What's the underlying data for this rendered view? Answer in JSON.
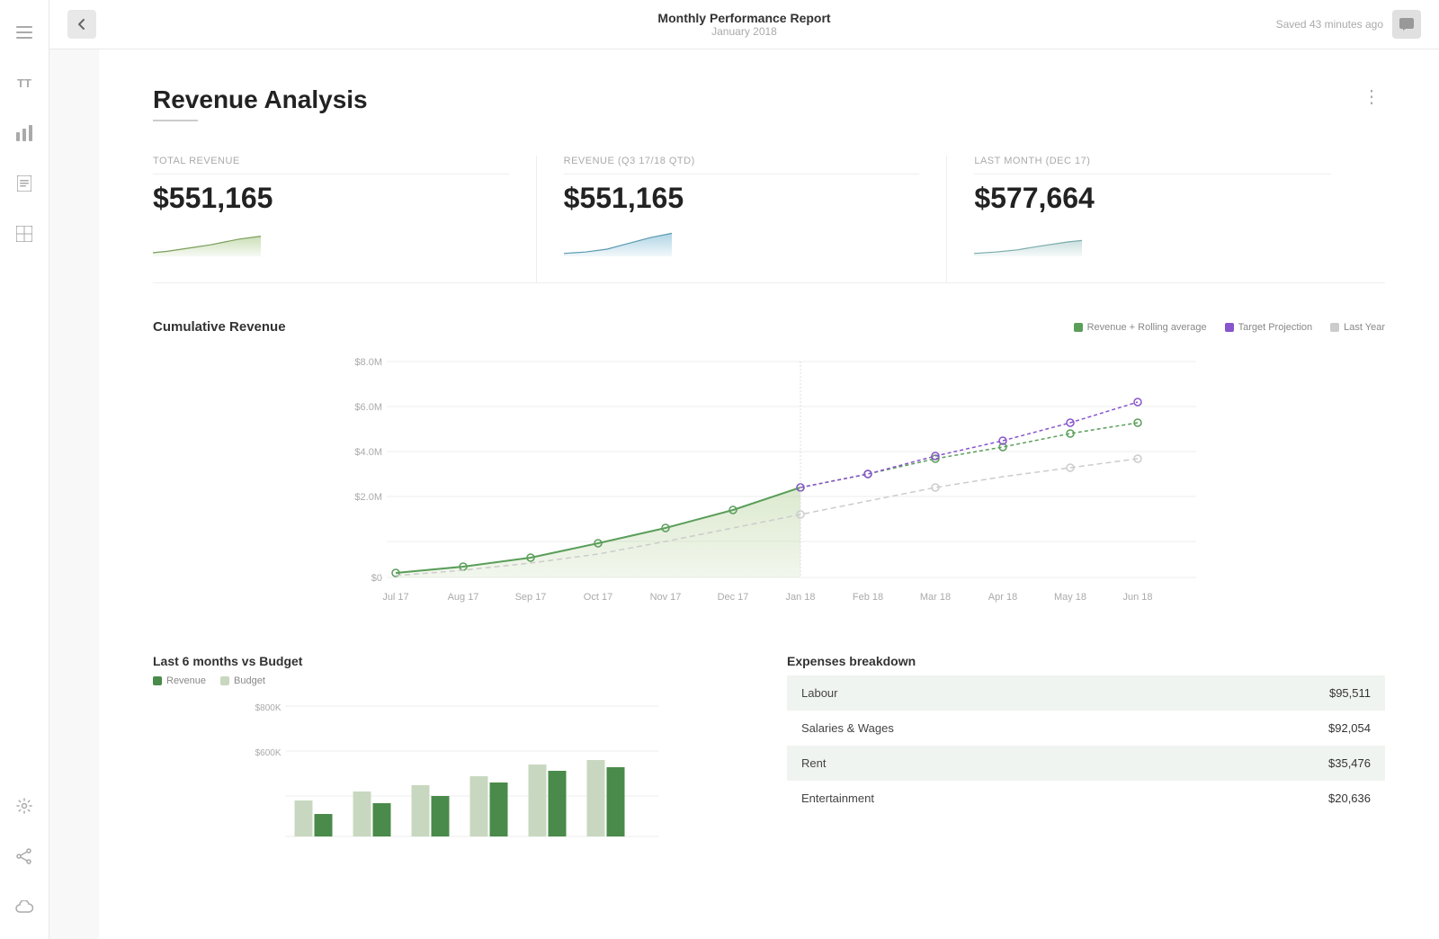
{
  "topbar": {
    "back_label": "←",
    "title": "Monthly Performance Report",
    "subtitle": "January 2018",
    "save_status": "Saved 43 minutes ago",
    "chat_icon": "💬"
  },
  "sidebar": {
    "icons": [
      {
        "name": "menu-icon",
        "glyph": "☰"
      },
      {
        "name": "text-icon",
        "glyph": "TT"
      },
      {
        "name": "chart-icon",
        "glyph": "📊"
      },
      {
        "name": "table-icon",
        "glyph": "📋"
      },
      {
        "name": "grid-icon",
        "glyph": "⊞"
      }
    ],
    "bottom_icons": [
      {
        "name": "settings-icon",
        "glyph": "⚙"
      },
      {
        "name": "share-icon",
        "glyph": "↗"
      },
      {
        "name": "cloud-icon",
        "glyph": "☁"
      }
    ]
  },
  "section": {
    "title": "Revenue Analysis",
    "more_label": "⋮"
  },
  "kpis": [
    {
      "label": "TOTAL REVENUE",
      "value": "$551,165",
      "sparkline_color": "#a8c987"
    },
    {
      "label": "REVENUE (Q3 17/18 QTD)",
      "value": "$551,165",
      "sparkline_color": "#7bb8d4"
    },
    {
      "label": "LAST MONTH (Dec 17)",
      "value": "$577,664",
      "sparkline_color": "#a8c9c9"
    }
  ],
  "cumulative_chart": {
    "title": "Cumulative Revenue",
    "y_labels": [
      "$8.0M",
      "$6.0M",
      "$4.0M",
      "$2.0M",
      "$0"
    ],
    "x_labels": [
      "Jul 17",
      "Aug 17",
      "Sep 17",
      "Oct 17",
      "Nov 17",
      "Dec 17",
      "Jan 18",
      "Feb 18",
      "Mar 18",
      "Apr 18",
      "May 18",
      "Jun 18"
    ],
    "legend": [
      {
        "label": "Revenue + Rolling average",
        "color": "#5a9e5a"
      },
      {
        "label": "Target Projection",
        "color": "#8855cc"
      },
      {
        "label": "Last Year",
        "color": "#cccccc"
      }
    ]
  },
  "bar_chart": {
    "title": "Last 6 months vs Budget",
    "y_labels": [
      "$800K",
      "$600K"
    ],
    "legend": [
      {
        "label": "Revenue",
        "color": "#4a8a4a"
      },
      {
        "label": "Budget",
        "color": "#c8d8c0"
      }
    ]
  },
  "expenses": {
    "title": "Expenses breakdown",
    "items": [
      {
        "label": "Labour",
        "amount": "$95,511"
      },
      {
        "label": "Salaries & Wages",
        "amount": "$92,054"
      },
      {
        "label": "Rent",
        "amount": "$35,476"
      },
      {
        "label": "Entertainment",
        "amount": "$20,636"
      }
    ]
  }
}
